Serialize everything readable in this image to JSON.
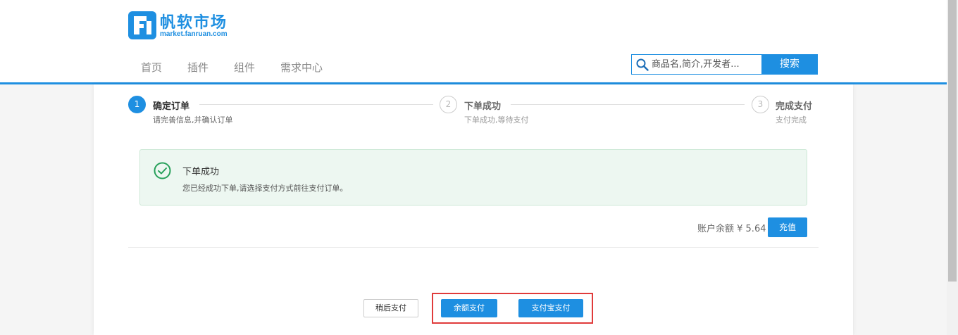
{
  "header": {
    "logo_title": "帆软市场",
    "logo_subtitle": "market.fanruan.com",
    "nav": [
      "首页",
      "插件",
      "组件",
      "需求中心"
    ],
    "search_placeholder": "商品名,简介,开发者...",
    "search_button": "搜索"
  },
  "steps": [
    {
      "number": "1",
      "title": "确定订单",
      "desc": "请完善信息,并确认订单",
      "state": "active"
    },
    {
      "number": "2",
      "title": "下单成功",
      "desc": "下单成功,等待支付",
      "state": "inactive"
    },
    {
      "number": "3",
      "title": "完成支付",
      "desc": "支付完成",
      "state": "inactive"
    }
  ],
  "alert": {
    "icon": "check-circle-icon",
    "title": "下单成功",
    "desc": "您已经成功下单,请选择支付方式前往支付订单。"
  },
  "account": {
    "balance_label": "账户余额 ¥ 5.64",
    "recharge_button": "充值"
  },
  "actions": {
    "later_button": "稍后支付",
    "balance_pay_button": "余额支付",
    "alipay_button": "支付宝支付"
  },
  "colors": {
    "accent": "#1e8fe1",
    "success": "#27a05a",
    "highlight": "#e03b3b"
  }
}
